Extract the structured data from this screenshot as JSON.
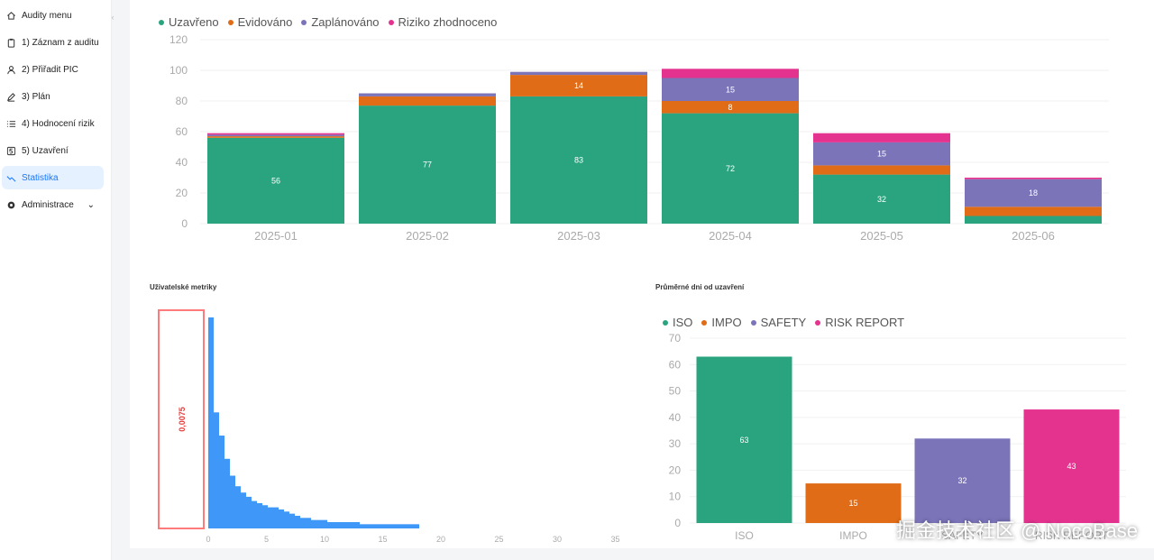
{
  "sidebar": {
    "collapse_icon": "chevron-left-icon",
    "items": [
      {
        "label": "Audity menu",
        "icon": "home-icon",
        "active": false
      },
      {
        "label": "1) Záznam z auditu",
        "icon": "clipboard-icon",
        "active": false
      },
      {
        "label": "2) Přiřadit PIC",
        "icon": "user-icon",
        "active": false
      },
      {
        "label": "3) Plán",
        "icon": "edit-icon",
        "active": false
      },
      {
        "label": "4) Hodnocení rizik",
        "icon": "list-icon",
        "active": false
      },
      {
        "label": "5) Uzavření",
        "icon": "number-five-icon",
        "active": false
      },
      {
        "label": "Statistika",
        "icon": "line-chart-icon",
        "active": true
      },
      {
        "label": "Administrace",
        "icon": "settings-icon",
        "active": false,
        "has_submenu": true
      }
    ]
  },
  "colors": {
    "green": "#2aa47e",
    "orange": "#e06c17",
    "purple": "#7b74b9",
    "pink": "#e4338f",
    "blue": "#3f97f8",
    "accent": "#1677ff",
    "outlier": "#ff7b7b"
  },
  "charts": {
    "monthly": {
      "legend": [
        "Uzavřeno",
        "Evidováno",
        "Zaplánováno",
        "Riziko zhodnoceno"
      ]
    },
    "histogram": {
      "title": "Uživatelské metriky",
      "outlier_label": "0,0075"
    },
    "category": {
      "title": "Průměrné dni od uzavření",
      "legend": [
        "ISO",
        "IMPO",
        "SAFETY",
        "RISK REPORT"
      ]
    }
  },
  "chart_data": [
    {
      "type": "bar",
      "stacked": true,
      "categories": [
        "2025-01",
        "2025-02",
        "2025-03",
        "2025-04",
        "2025-05",
        "2025-06"
      ],
      "series": [
        {
          "name": "Uzavřeno",
          "values": [
            56,
            77,
            83,
            72,
            32,
            5
          ],
          "labels": [
            "56",
            "77",
            "83",
            "72",
            "32",
            ""
          ]
        },
        {
          "name": "Evidováno",
          "values": [
            1,
            6,
            14,
            8,
            6,
            6
          ],
          "labels": [
            "",
            "",
            "14",
            "8",
            "",
            ""
          ]
        },
        {
          "name": "Zaplánováno",
          "values": [
            1,
            2,
            2,
            15,
            15,
            18
          ],
          "labels": [
            "",
            "",
            "",
            "15",
            "15",
            "18"
          ]
        },
        {
          "name": "Riziko zhodnoceno",
          "values": [
            1,
            0,
            0,
            6,
            6,
            1
          ],
          "labels": [
            "",
            "",
            "",
            "",
            "",
            ""
          ]
        }
      ],
      "yticks": [
        "0",
        "20",
        "40",
        "60",
        "80",
        "100",
        "120"
      ],
      "ylim": [
        0,
        120
      ],
      "legend_position": "top-left"
    },
    {
      "type": "bar",
      "subtype": "histogram",
      "values": [
        100,
        55,
        44,
        33,
        25,
        20,
        17,
        15,
        13,
        12,
        11,
        10,
        10,
        9,
        8,
        7,
        6,
        5,
        5,
        4,
        4,
        4,
        3,
        3,
        3,
        3,
        3,
        3,
        2,
        2,
        2,
        2,
        2,
        2,
        2,
        2,
        2,
        2,
        2
      ],
      "xticks": [
        "0",
        "5",
        "10",
        "15",
        "20",
        "25",
        "30",
        "35"
      ],
      "outlier_label": "0,0075"
    },
    {
      "type": "bar",
      "categories": [
        "ISO",
        "IMPO",
        "SAFETY",
        "RISK REPORT"
      ],
      "series": [
        {
          "name": "ISO",
          "values": [
            63
          ],
          "labels": [
            "63"
          ]
        },
        {
          "name": "IMPO",
          "values": [
            15
          ],
          "labels": [
            "15"
          ]
        },
        {
          "name": "SAFETY",
          "values": [
            32
          ],
          "labels": [
            "32"
          ]
        },
        {
          "name": "RISK REPORT",
          "values": [
            43
          ],
          "labels": [
            "43"
          ]
        }
      ],
      "yticks": [
        "0",
        "10",
        "20",
        "30",
        "40",
        "50",
        "60",
        "70"
      ],
      "ylim": [
        0,
        70
      ],
      "legend_position": "top-left"
    }
  ],
  "watermark": "掘金技术社区 @ NocoBase"
}
